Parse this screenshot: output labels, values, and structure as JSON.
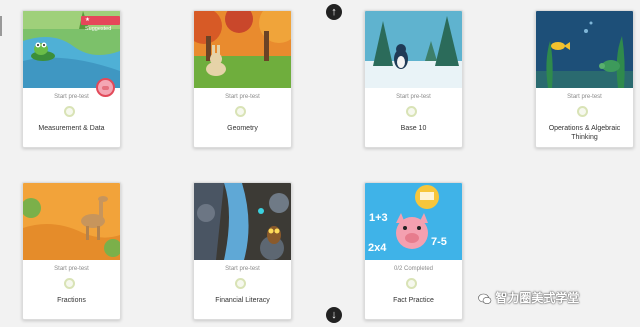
{
  "nav": {
    "up_icon": "arrow-up-circle-icon",
    "down_icon": "arrow-down-circle-icon",
    "up_glyph": "↑",
    "down_glyph": "↓"
  },
  "cards": [
    {
      "title": "Measurement & Data",
      "status": "Start pre-test",
      "art": "frog in pond",
      "badge": "★ Suggested"
    },
    {
      "title": "Geometry",
      "status": "Start pre-test",
      "art": "bunny in autumn forest"
    },
    {
      "title": "Base 10",
      "status": "Start pre-test",
      "art": "penguin in snowy forest"
    },
    {
      "title": "Operations & Algebraic Thinking",
      "status": "Start pre-test",
      "art": "fish and turtle underwater"
    },
    {
      "title": "Fractions",
      "status": "Start pre-test",
      "art": "camel in desert"
    },
    {
      "title": "Financial Literacy",
      "status": "Start pre-test",
      "art": "owl by waterfall"
    },
    {
      "title": "Fact Practice",
      "status": "0/2 Completed",
      "art": "pig with math facts",
      "art_texts": [
        "1+3",
        "2x4",
        "7-5"
      ]
    }
  ],
  "watermark": {
    "text": "智力圈美式学堂",
    "icon": "wechat-icon"
  },
  "colors": {
    "badge": "#e5475a",
    "card_bg": "#ffffff",
    "page_bg": "#f2f2f2",
    "medal": "#d9e3b6"
  }
}
